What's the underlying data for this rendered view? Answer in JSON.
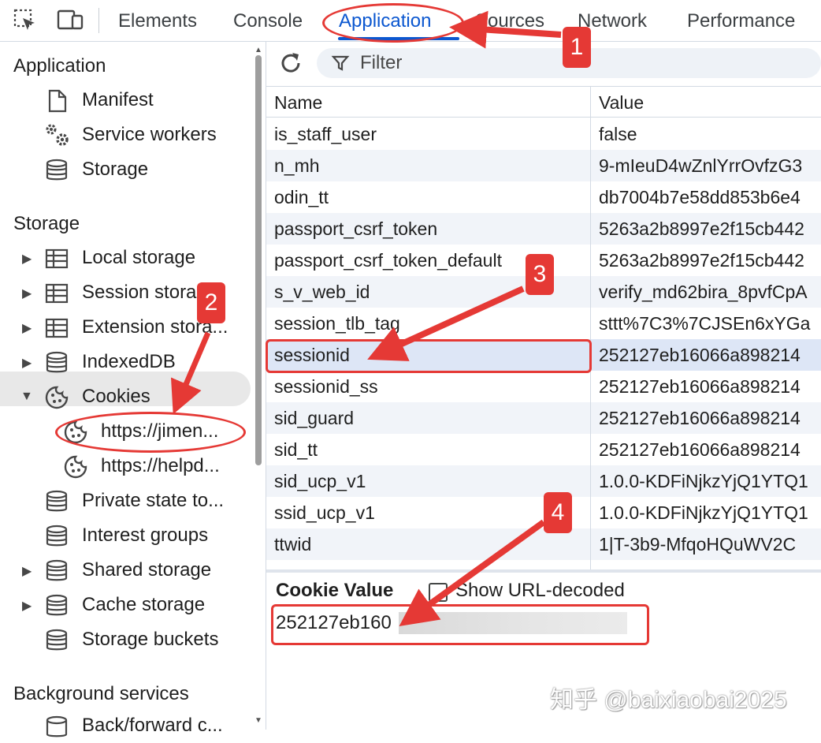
{
  "toolbar_tabs": [
    "Elements",
    "Console",
    "Application",
    "Sources",
    "Network",
    "Performance"
  ],
  "active_tab": "Application",
  "sidebar": {
    "application_title": "Application",
    "application_items": [
      "Manifest",
      "Service workers",
      "Storage"
    ],
    "storage_title": "Storage",
    "storage_items": [
      "Local storage",
      "Session stora",
      "Extension stora...",
      "IndexedDB",
      "Cookies"
    ],
    "cookie_origins": [
      "https://jimen...",
      "https://helpd..."
    ],
    "storage_items_2": [
      "Private state to...",
      "Interest groups",
      "Shared storage",
      "Cache storage",
      "Storage buckets"
    ],
    "background_title": "Background services",
    "background_items": [
      "Back/forward c..."
    ]
  },
  "filter": {
    "placeholder": "Filter"
  },
  "table": {
    "headers": {
      "name": "Name",
      "value": "Value"
    },
    "rows": [
      {
        "name": "is_staff_user",
        "value": "false"
      },
      {
        "name": "n_mh",
        "value": "9-mIeuD4wZnlYrrOvfzG3"
      },
      {
        "name": "odin_tt",
        "value": "db7004b7e58dd853b6e4"
      },
      {
        "name": "passport_csrf_token",
        "value": "5263a2b8997e2f15cb442"
      },
      {
        "name": "passport_csrf_token_default",
        "value": "5263a2b8997e2f15cb442"
      },
      {
        "name": "s_v_web_id",
        "value": "verify_md62bira_8pvfCpA"
      },
      {
        "name": "session_tlb_tag",
        "value": "sttt%7C3%7CJSEn6xYGa"
      },
      {
        "name": "sessionid",
        "value": "252127eb16066a898214"
      },
      {
        "name": "sessionid_ss",
        "value": "252127eb16066a898214"
      },
      {
        "name": "sid_guard",
        "value": "252127eb16066a898214"
      },
      {
        "name": "sid_tt",
        "value": "252127eb16066a898214"
      },
      {
        "name": "sid_ucp_v1",
        "value": "1.0.0-KDFiNjkzYjQ1YTQ1"
      },
      {
        "name": "ssid_ucp_v1",
        "value": "1.0.0-KDFiNjkzYjQ1YTQ1"
      },
      {
        "name": "ttwid",
        "value": "1|T-3b9-MfqoHQuWV2C"
      }
    ],
    "selected_row": "sessionid"
  },
  "cookie_value_panel": {
    "title": "Cookie Value",
    "show_url_decoded_label": "Show URL-decoded",
    "value": "252127eb160"
  },
  "annotations": [
    "1",
    "2",
    "3",
    "4"
  ],
  "annotation_color": "#e53935",
  "accent_color": "#0b57d0",
  "watermark": "知乎 @baixiaobai2025"
}
